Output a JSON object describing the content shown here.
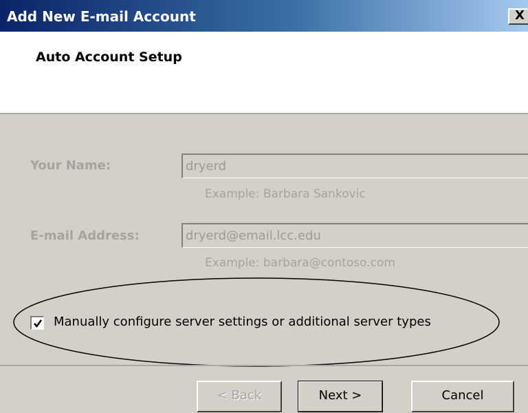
{
  "window": {
    "title": "Add New E-mail Account",
    "close_label": "X"
  },
  "header": {
    "heading": "Auto Account Setup"
  },
  "form": {
    "name": {
      "label": "Your Name:",
      "value": "dryerd",
      "example": "Example: Barbara Sankovic"
    },
    "email": {
      "label": "E-mail Address:",
      "value": "dryerd@email.lcc.edu",
      "example": "Example: barbara@contoso.com"
    },
    "manual_config": {
      "label": "Manually configure server settings or additional server types",
      "checked": true
    }
  },
  "buttons": {
    "back": "< Back",
    "next": "Next >",
    "cancel": "Cancel"
  }
}
